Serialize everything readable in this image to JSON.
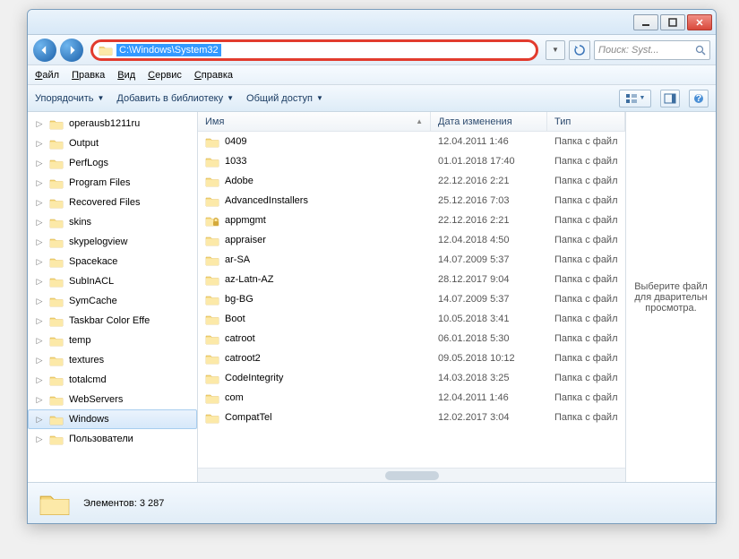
{
  "addressBar": {
    "path": "C:\\Windows\\System32"
  },
  "search": {
    "placeholder": "Поиск: Syst..."
  },
  "menu": {
    "file": "Файл",
    "edit": "Правка",
    "view": "Вид",
    "tools": "Сервис",
    "help": "Справка"
  },
  "toolbar": {
    "organize": "Упорядочить",
    "addToLibrary": "Добавить в библиотеку",
    "share": "Общий доступ"
  },
  "columns": {
    "name": "Имя",
    "date": "Дата изменения",
    "type": "Тип"
  },
  "tree": {
    "items": [
      {
        "label": "operausb1211ru",
        "sel": false
      },
      {
        "label": "Output",
        "sel": false
      },
      {
        "label": "PerfLogs",
        "sel": false
      },
      {
        "label": "Program Files",
        "sel": false
      },
      {
        "label": "Recovered Files",
        "sel": false
      },
      {
        "label": "skins",
        "sel": false
      },
      {
        "label": "skypelogview",
        "sel": false
      },
      {
        "label": "Spacekace",
        "sel": false
      },
      {
        "label": "SubInACL",
        "sel": false
      },
      {
        "label": "SymCache",
        "sel": false
      },
      {
        "label": "Taskbar Color Effe",
        "sel": false
      },
      {
        "label": "temp",
        "sel": false
      },
      {
        "label": "textures",
        "sel": false
      },
      {
        "label": "totalcmd",
        "sel": false
      },
      {
        "label": "WebServers",
        "sel": false
      },
      {
        "label": "Windows",
        "sel": true
      },
      {
        "label": "Пользователи",
        "sel": false
      }
    ]
  },
  "files": [
    {
      "name": "0409",
      "date": "12.04.2011 1:46",
      "type": "Папка с файл",
      "locked": false
    },
    {
      "name": "1033",
      "date": "01.01.2018 17:40",
      "type": "Папка с файл",
      "locked": false
    },
    {
      "name": "Adobe",
      "date": "22.12.2016 2:21",
      "type": "Папка с файл",
      "locked": false
    },
    {
      "name": "AdvancedInstallers",
      "date": "25.12.2016 7:03",
      "type": "Папка с файл",
      "locked": false
    },
    {
      "name": "appmgmt",
      "date": "22.12.2016 2:21",
      "type": "Папка с файл",
      "locked": true
    },
    {
      "name": "appraiser",
      "date": "12.04.2018 4:50",
      "type": "Папка с файл",
      "locked": false
    },
    {
      "name": "ar-SA",
      "date": "14.07.2009 5:37",
      "type": "Папка с файл",
      "locked": false
    },
    {
      "name": "az-Latn-AZ",
      "date": "28.12.2017 9:04",
      "type": "Папка с файл",
      "locked": false
    },
    {
      "name": "bg-BG",
      "date": "14.07.2009 5:37",
      "type": "Папка с файл",
      "locked": false
    },
    {
      "name": "Boot",
      "date": "10.05.2018 3:41",
      "type": "Папка с файл",
      "locked": false
    },
    {
      "name": "catroot",
      "date": "06.01.2018 5:30",
      "type": "Папка с файл",
      "locked": false
    },
    {
      "name": "catroot2",
      "date": "09.05.2018 10:12",
      "type": "Папка с файл",
      "locked": false
    },
    {
      "name": "CodeIntegrity",
      "date": "14.03.2018 3:25",
      "type": "Папка с файл",
      "locked": false
    },
    {
      "name": "com",
      "date": "12.04.2011 1:46",
      "type": "Папка с файл",
      "locked": false
    },
    {
      "name": "CompatTel",
      "date": "12.02.2017 3:04",
      "type": "Папка с файл",
      "locked": false
    }
  ],
  "preview": {
    "text": "Выберите файл для дварительн просмотра."
  },
  "status": {
    "label": "Элементов:",
    "count": "3 287"
  }
}
